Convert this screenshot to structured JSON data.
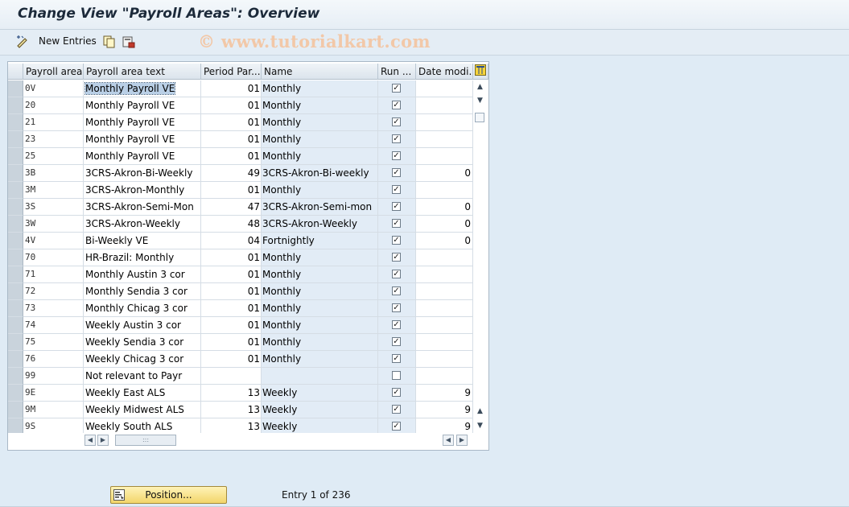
{
  "window": {
    "title": "Change View \"Payroll Areas\": Overview"
  },
  "toolbar": {
    "new_entries_label": "New Entries",
    "watermark": "© www.tutorialkart.com"
  },
  "table": {
    "columns": [
      "Payroll area",
      "Payroll area text",
      "Period Par...",
      "Name",
      "Run ...",
      "Date modi..."
    ],
    "rows": [
      {
        "area": "0V",
        "text": "Monthly Payroll  VE",
        "period": "01",
        "name": "Monthly",
        "run": true,
        "date": ""
      },
      {
        "area": "20",
        "text": "Monthly Payroll  VE",
        "period": "01",
        "name": "Monthly",
        "run": true,
        "date": ""
      },
      {
        "area": "21",
        "text": "Monthly Payroll  VE",
        "period": "01",
        "name": "Monthly",
        "run": true,
        "date": ""
      },
      {
        "area": "23",
        "text": "Monthly Payroll  VE",
        "period": "01",
        "name": "Monthly",
        "run": true,
        "date": ""
      },
      {
        "area": "25",
        "text": "Monthly Payroll  VE",
        "period": "01",
        "name": "Monthly",
        "run": true,
        "date": ""
      },
      {
        "area": "3B",
        "text": "3CRS-Akron-Bi-Weekly",
        "period": "49",
        "name": "3CRS-Akron-Bi-weekly",
        "run": true,
        "date": "0"
      },
      {
        "area": "3M",
        "text": "3CRS-Akron-Monthly",
        "period": "01",
        "name": "Monthly",
        "run": true,
        "date": ""
      },
      {
        "area": "3S",
        "text": "3CRS-Akron-Semi-Mon",
        "period": "47",
        "name": "3CRS-Akron-Semi-mon",
        "run": true,
        "date": "0"
      },
      {
        "area": "3W",
        "text": "3CRS-Akron-Weekly",
        "period": "48",
        "name": "3CRS-Akron-Weekly",
        "run": true,
        "date": "0"
      },
      {
        "area": "4V",
        "text": "Bi-Weekly VE",
        "period": "04",
        "name": "Fortnightly",
        "run": true,
        "date": "0"
      },
      {
        "area": "70",
        "text": "HR-Brazil: Monthly",
        "period": "01",
        "name": "Monthly",
        "run": true,
        "date": ""
      },
      {
        "area": "71",
        "text": "Monthly Austin 3 cor",
        "period": "01",
        "name": "Monthly",
        "run": true,
        "date": ""
      },
      {
        "area": "72",
        "text": "Monthly Sendia 3 cor",
        "period": "01",
        "name": "Monthly",
        "run": true,
        "date": ""
      },
      {
        "area": "73",
        "text": "Monthly Chicag 3 cor",
        "period": "01",
        "name": "Monthly",
        "run": true,
        "date": ""
      },
      {
        "area": "74",
        "text": "Weekly Austin 3 cor",
        "period": "01",
        "name": "Monthly",
        "run": true,
        "date": ""
      },
      {
        "area": "75",
        "text": "Weekly Sendia 3 cor",
        "period": "01",
        "name": "Monthly",
        "run": true,
        "date": ""
      },
      {
        "area": "76",
        "text": "Weekly Chicag 3 cor",
        "period": "01",
        "name": "Monthly",
        "run": true,
        "date": ""
      },
      {
        "area": "99",
        "text": "Not relevant to Payr",
        "period": "",
        "name": "",
        "run": false,
        "date": ""
      },
      {
        "area": "9E",
        "text": "Weekly East ALS",
        "period": "13",
        "name": "Weekly",
        "run": true,
        "date": "9"
      },
      {
        "area": "9M",
        "text": "Weekly Midwest ALS",
        "period": "13",
        "name": "Weekly",
        "run": true,
        "date": "9"
      },
      {
        "area": "9S",
        "text": "Weekly South ALS",
        "period": "13",
        "name": "Weekly",
        "run": true,
        "date": "9"
      }
    ]
  },
  "footer": {
    "position_label": "Position...",
    "entry_info": "Entry 1 of 236"
  },
  "colors": {
    "accent": "#f2d56a",
    "header": "#dbe4ec",
    "shaded_column": "#e2ecf6"
  }
}
